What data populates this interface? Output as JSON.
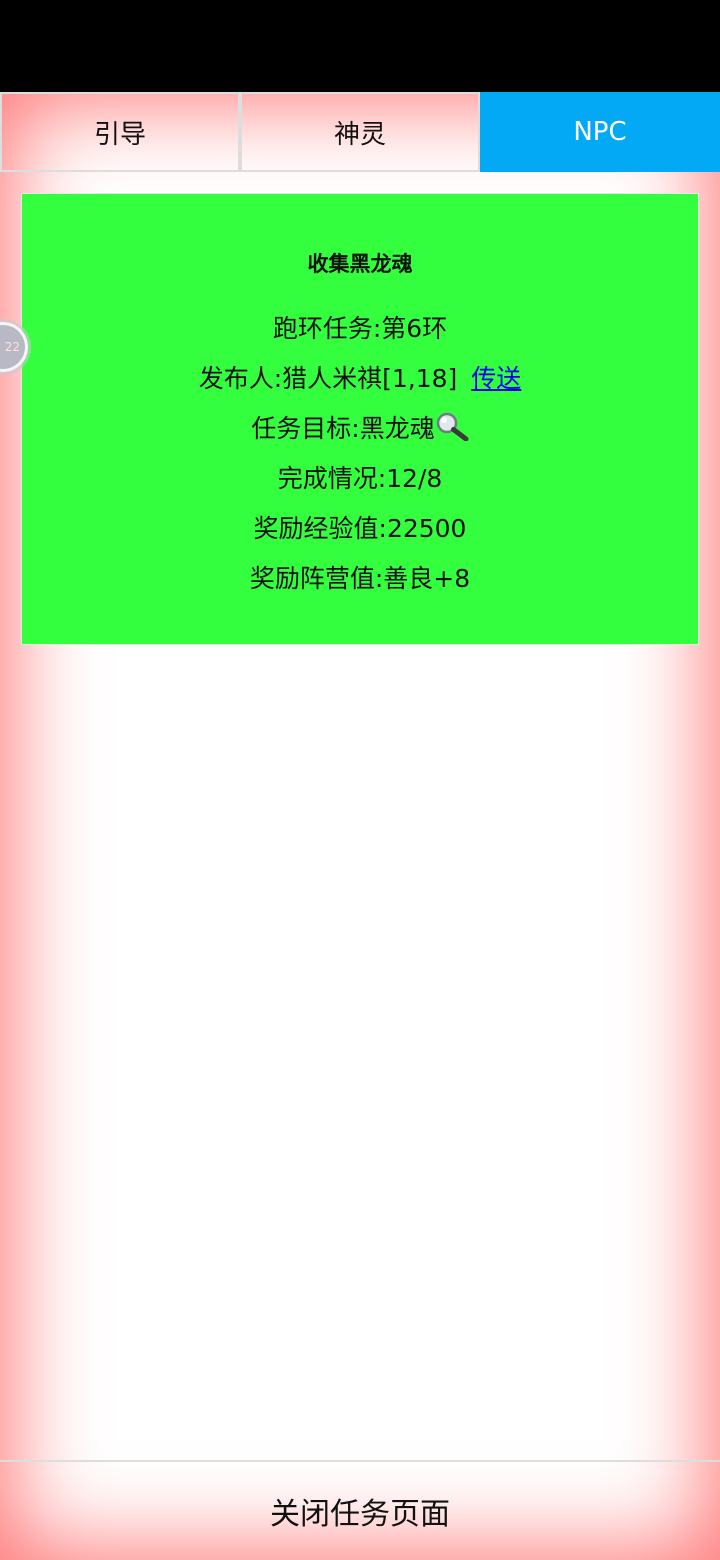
{
  "tabs": [
    {
      "label": "引导",
      "active": false
    },
    {
      "label": "神灵",
      "active": false
    },
    {
      "label": "NPC",
      "active": true
    }
  ],
  "task": {
    "title": "收集黑龙魂",
    "ring_label": "跑环任务:第6环",
    "publisher_label": "发布人:猎人米祺[1,18]",
    "teleport_link": "传送",
    "target_label": "任务目标:黑龙魂",
    "target_icon": "magnifier-icon",
    "progress_label": "完成情况:12/8",
    "exp_reward_label": "奖励经验值:22500",
    "faction_reward_label": "奖励阵营值:善良+8"
  },
  "float_ball": {
    "text": "22"
  },
  "footer": {
    "close_label": "关闭任务页面"
  },
  "colors": {
    "status_bar": "#000000",
    "tab_active": "#03a9f4",
    "card_bg": "#33ff3f",
    "link": "#0000ee",
    "frame_glow": "#ff0000"
  }
}
